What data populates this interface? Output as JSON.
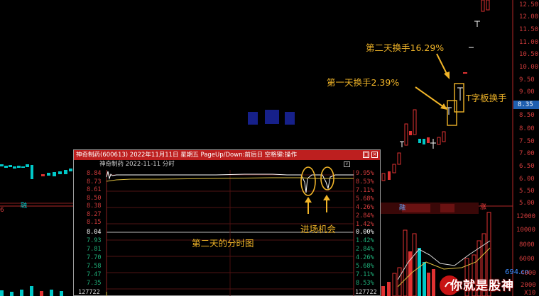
{
  "right_axis": {
    "labels": [
      "12.50",
      "12.00",
      "11.50",
      "11.00",
      "10.50",
      "10.00",
      "9.50",
      "9.00",
      "8.50",
      "8.00",
      "7.50",
      "7.00",
      "6.50",
      "6.00",
      "5.50",
      "5.00"
    ],
    "highlight": "8.35"
  },
  "volume_axis": {
    "labels": [
      "12000",
      "10000",
      "8000",
      "6000",
      "4000",
      "2000",
      "X10"
    ]
  },
  "annotations": {
    "day2_turnover": "第二天换手16.29%",
    "day1_turnover": "第一天换手2.39%",
    "t_board": "T字板换手",
    "entry": "进场机会",
    "intraday": "第二天的分时图",
    "left_tag": "融",
    "left_num": "6",
    "stock_tag_a": "融",
    "stock_tag_b": "涨"
  },
  "popup": {
    "title": "神奇制药(600613) 2022年11月11日 星期五 PageUp/Down:前后日 空格键:操作",
    "subtitle": "神奇制药  2022-11-11 分时",
    "sub_button": "∨",
    "close_button": "×",
    "restore_button": "□",
    "price_left": [
      "8.84",
      "8.73",
      "8.61",
      "8.50",
      "8.38",
      "8.27",
      "8.15",
      "8.04",
      "7.93",
      "7.81",
      "7.70",
      "7.58",
      "7.47",
      "7.35"
    ],
    "pct_right": [
      "9.95%",
      "8.53%",
      "7.11%",
      "5.68%",
      "4.26%",
      "2.84%",
      "1.42%",
      "0.00%",
      "1.42%",
      "2.84%",
      "4.26%",
      "5.68%",
      "7.11%",
      "8.53%"
    ],
    "volume_left": "127722",
    "volume_right": "127722"
  },
  "footer": {
    "brand": "你就是股神",
    "site": "694.cn"
  },
  "colors": {
    "up": "#e03232",
    "down": "#00c8c8",
    "accent": "#f0b428",
    "title_bar": "#bd1f1f"
  }
}
